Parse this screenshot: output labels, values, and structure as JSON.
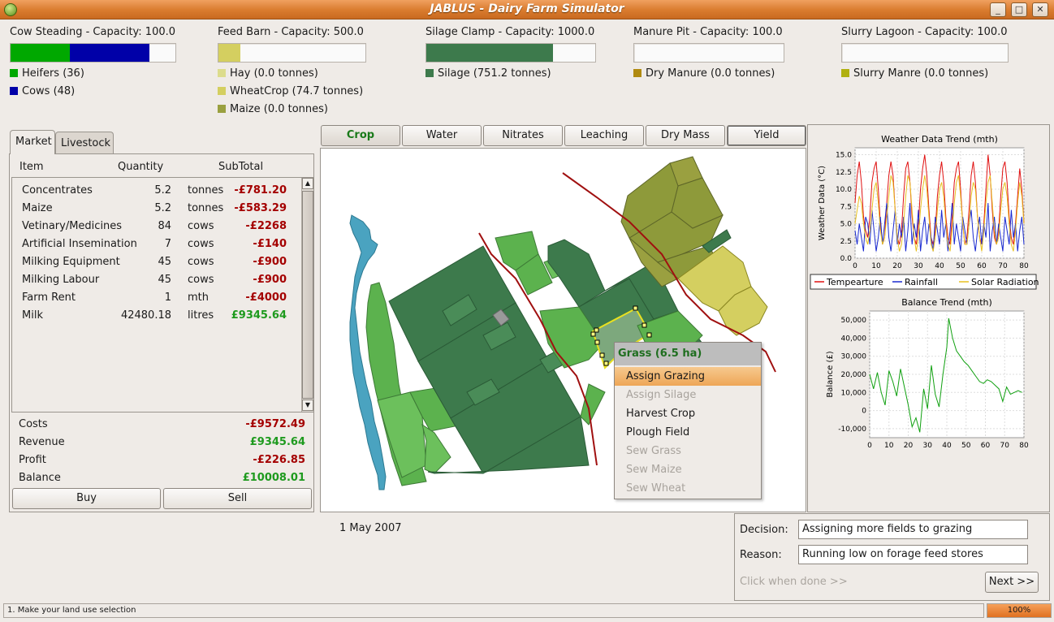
{
  "window": {
    "title": "JABLUS - Dairy Farm Simulator",
    "buttons": [
      "_",
      "□",
      "✕"
    ]
  },
  "stores": [
    {
      "title": "Cow Steading - Capacity: 100.0",
      "fills": [
        {
          "fraction": 0.36,
          "color": "#00a800"
        },
        {
          "fraction": 0.48,
          "color": "#0000a8"
        }
      ],
      "legend": [
        {
          "label": "Heifers (36)",
          "color": "#00a800"
        },
        {
          "label": "Cows (48)",
          "color": "#0000a8"
        }
      ]
    },
    {
      "title": "Feed Barn - Capacity: 500.0",
      "fills": [
        {
          "fraction": 0.149,
          "color": "#d4cf60"
        }
      ],
      "legend": [
        {
          "label": "Hay (0.0 tonnes)",
          "color": "#dcdc8c"
        },
        {
          "label": "WheatCrop (74.7 tonnes)",
          "color": "#d4cf60"
        },
        {
          "label": "Maize (0.0 tonnes)",
          "color": "#9aa040"
        }
      ]
    },
    {
      "title": "Silage Clamp - Capacity: 1000.0",
      "fills": [
        {
          "fraction": 0.751,
          "color": "#3d7a4c"
        }
      ],
      "legend": [
        {
          "label": "Silage (751.2 tonnes)",
          "color": "#3d7a4c"
        }
      ]
    },
    {
      "title": "Manure Pit - Capacity: 100.0",
      "fills": [],
      "legend": [
        {
          "label": "Dry Manure (0.0 tonnes)",
          "color": "#b08a10"
        }
      ]
    },
    {
      "title": "Slurry Lagoon - Capacity: 100.0",
      "fills": [],
      "legend": [
        {
          "label": "Slurry Manre (0.0 tonnes)",
          "color": "#b0b010"
        }
      ]
    }
  ],
  "left_tabs": [
    "Market",
    "Livestock"
  ],
  "market": {
    "headers": [
      "Item",
      "Quantity",
      "SubTotal"
    ],
    "rows": [
      {
        "item": "Concentrates",
        "qty": "5.2",
        "unit": "tonnes",
        "subtotal": "-£781.20",
        "neg": true
      },
      {
        "item": "Maize",
        "qty": "5.2",
        "unit": "tonnes",
        "subtotal": "-£583.29",
        "neg": true
      },
      {
        "item": "Vetinary/Medicines",
        "qty": "84",
        "unit": "cows",
        "subtotal": "-£2268",
        "neg": true
      },
      {
        "item": "Artificial Insemination",
        "qty": "7",
        "unit": "cows",
        "subtotal": "-£140",
        "neg": true
      },
      {
        "item": "Milking Equipment",
        "qty": "45",
        "unit": "cows",
        "subtotal": "-£900",
        "neg": true
      },
      {
        "item": "Milking Labour",
        "qty": "45",
        "unit": "cows",
        "subtotal": "-£900",
        "neg": true
      },
      {
        "item": "Farm Rent",
        "qty": "1",
        "unit": "mth",
        "subtotal": "-£4000",
        "neg": true
      },
      {
        "item": "Milk",
        "qty": "42480.18",
        "unit": "litres",
        "subtotal": "£9345.64",
        "neg": false
      }
    ],
    "summary": [
      {
        "label": "Costs",
        "value": "-£9572.49",
        "neg": true
      },
      {
        "label": "Revenue",
        "value": "£9345.64",
        "neg": false
      },
      {
        "label": "Profit",
        "value": "-£226.85",
        "neg": true
      },
      {
        "label": "Balance",
        "value": "£10008.01",
        "neg": false
      }
    ],
    "buy_label": "Buy",
    "sell_label": "Sell"
  },
  "map_tabs": [
    "Crop",
    "Water",
    "Nitrates",
    "Leaching",
    "Dry Mass",
    "Yield"
  ],
  "context_menu": {
    "title": "Grass (6.5 ha)",
    "items": [
      {
        "label": "Assign Grazing",
        "state": "selected"
      },
      {
        "label": "Assign Silage",
        "state": "disabled"
      },
      {
        "label": "Harvest Crop",
        "state": "enabled"
      },
      {
        "label": "Plough Field",
        "state": "enabled"
      },
      {
        "label": "Sew Grass",
        "state": "disabled"
      },
      {
        "label": "Sew Maize",
        "state": "disabled"
      },
      {
        "label": "Sew Wheat",
        "state": "disabled"
      }
    ]
  },
  "date": "1 May 2007",
  "decision": {
    "decision_label": "Decision:",
    "decision_value": "Assigning more fields to grazing",
    "reason_label": "Reason:",
    "reason_value": "Running low on forage feed stores",
    "hint": "Click when done >>",
    "next_label": "Next >>"
  },
  "status": {
    "message": "1. Make your land use selection",
    "progress_text": "100%",
    "progress": 1.0
  },
  "chart_data": [
    {
      "type": "line",
      "title": "Weather Data Trend (mth)",
      "ylabel": "Weather Data (°C)",
      "xlabel": "",
      "xlim": [
        0,
        80
      ],
      "ylim": [
        0,
        16
      ],
      "xticks": [
        0,
        10,
        20,
        30,
        40,
        50,
        60,
        70,
        80
      ],
      "yticks": [
        "0.0",
        "2.5",
        "5.0",
        "7.5",
        "10.0",
        "12.5",
        "15.0"
      ],
      "legend_position": "bottom",
      "series": [
        {
          "name": "Tempearture",
          "color": "#e01010",
          "values": [
            8,
            12,
            14,
            11,
            6,
            4,
            3,
            6,
            11,
            13,
            14,
            10,
            5,
            2,
            3,
            8,
            12,
            14,
            12,
            7,
            3,
            2,
            4,
            9,
            13,
            14,
            11,
            6,
            3,
            2,
            5,
            10,
            13,
            15,
            12,
            7,
            3,
            2,
            4,
            9,
            12,
            14,
            11,
            6,
            3,
            2,
            6,
            11,
            13,
            14,
            10,
            5,
            2,
            3,
            7,
            12,
            14,
            11,
            6,
            3,
            2,
            5,
            10,
            15,
            12,
            7,
            3,
            2,
            4,
            9,
            13,
            14,
            11,
            6,
            3,
            2,
            5,
            9,
            13,
            10,
            5
          ]
        },
        {
          "name": "Rainfall",
          "color": "#1a2ad0",
          "values": [
            4,
            2,
            5,
            3,
            1,
            6,
            5,
            2,
            7,
            4,
            1,
            3,
            6,
            2,
            5,
            8,
            3,
            1,
            4,
            7,
            2,
            5,
            3,
            6,
            1,
            4,
            8,
            2,
            5,
            3,
            7,
            1,
            4,
            6,
            2,
            5,
            3,
            1,
            6,
            4,
            2,
            7,
            3,
            5,
            1,
            4,
            8,
            2,
            5,
            3,
            1,
            6,
            4,
            2,
            5,
            7,
            3,
            1,
            4,
            6,
            2,
            5,
            3,
            8,
            1,
            4,
            6,
            2,
            5,
            3,
            1,
            6,
            4,
            2,
            7,
            3,
            5,
            1,
            4,
            6,
            2
          ]
        },
        {
          "name": "Solar Radiation",
          "color": "#e8c020",
          "values": [
            5,
            7,
            9,
            8,
            5,
            3,
            2,
            4,
            7,
            10,
            11,
            8,
            4,
            2,
            3,
            6,
            9,
            12,
            11,
            7,
            3,
            1,
            2,
            5,
            9,
            12,
            11,
            7,
            3,
            1,
            3,
            7,
            10,
            12,
            10,
            6,
            2,
            1,
            3,
            7,
            10,
            11,
            9,
            5,
            2,
            1,
            4,
            8,
            11,
            12,
            9,
            5,
            2,
            2,
            5,
            9,
            11,
            10,
            6,
            3,
            1,
            4,
            8,
            11,
            12,
            8,
            4,
            2,
            3,
            7,
            10,
            11,
            9,
            5,
            2,
            1,
            4,
            8,
            11,
            9,
            5
          ]
        }
      ]
    },
    {
      "type": "line",
      "title": "Balance Trend (mth)",
      "ylabel": "Balance (£)",
      "xlabel": "",
      "xlim": [
        0,
        80
      ],
      "ylim": [
        -15000,
        55000
      ],
      "xticks": [
        0,
        10,
        20,
        30,
        40,
        50,
        60,
        70,
        80
      ],
      "yticks": [
        "-10,000",
        "0",
        "10,000",
        "20,000",
        "30,000",
        "40,000",
        "50,000"
      ],
      "series": [
        {
          "name": "Balance",
          "color": "#10a010",
          "x": [
            0,
            2,
            4,
            6,
            8,
            10,
            12,
            14,
            16,
            18,
            20,
            22,
            24,
            26,
            28,
            30,
            32,
            34,
            36,
            38,
            40,
            41,
            43,
            45,
            47,
            49,
            51,
            53,
            55,
            57,
            59,
            61,
            63,
            65,
            67,
            69,
            71,
            73,
            75,
            77,
            79
          ],
          "values": [
            20000,
            12000,
            21000,
            10000,
            3000,
            22000,
            16000,
            8000,
            23000,
            13000,
            3000,
            -9000,
            -4000,
            -12000,
            12000,
            1000,
            25000,
            9000,
            2000,
            20000,
            35000,
            51000,
            40000,
            33000,
            30000,
            27000,
            25000,
            22000,
            19000,
            16000,
            15000,
            17000,
            16000,
            14000,
            12000,
            5000,
            13000,
            9000,
            10000,
            11000,
            10000
          ]
        }
      ]
    }
  ]
}
